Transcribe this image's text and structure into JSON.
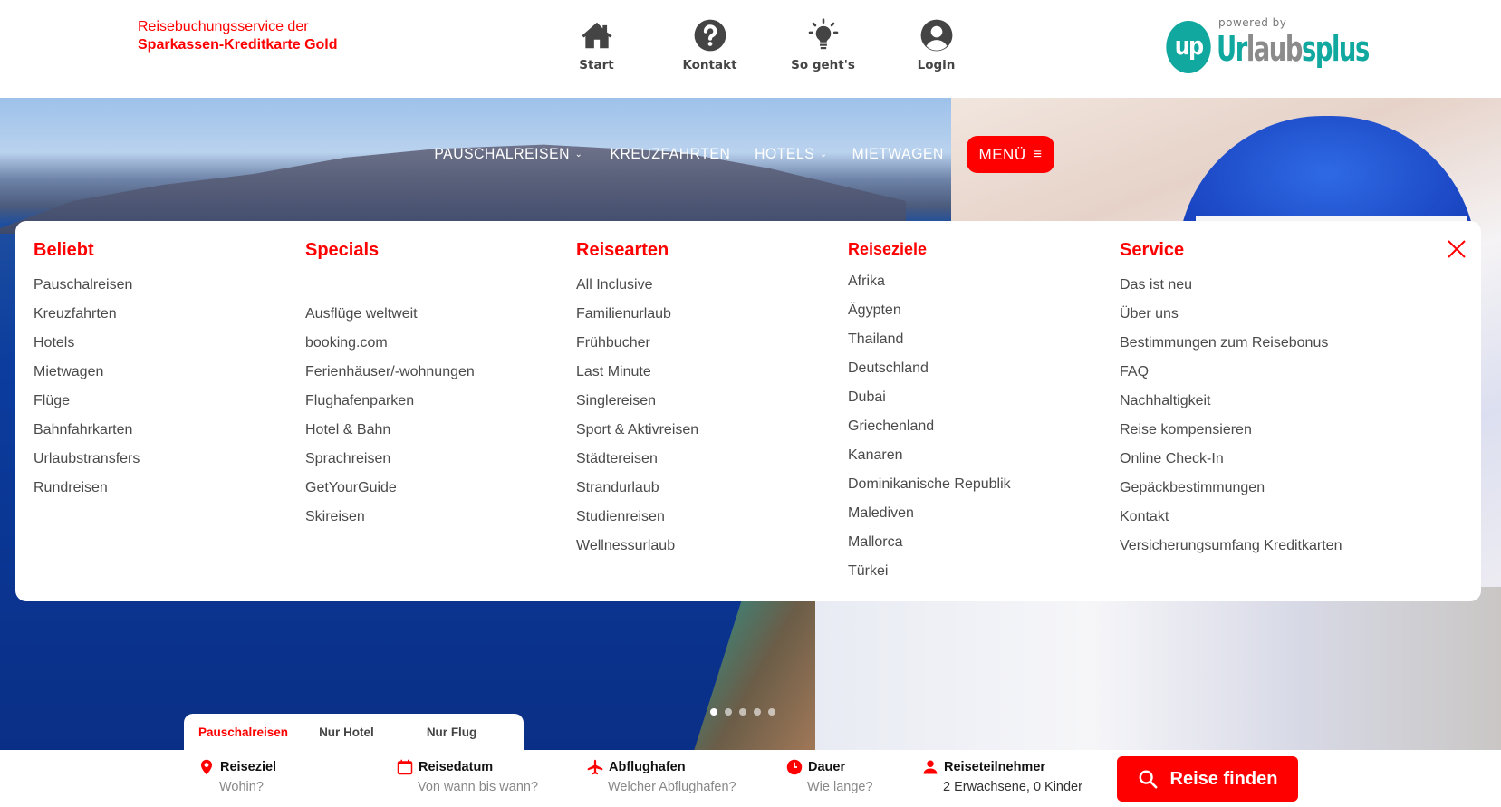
{
  "brand": {
    "line1": "Reisebuchungsservice der",
    "line2": "Sparkassen-Kreditkarte Gold",
    "color": "#ff0000"
  },
  "topnav": [
    {
      "label": "Start",
      "icon": "home-icon"
    },
    {
      "label": "Kontakt",
      "icon": "question-circle-icon"
    },
    {
      "label": "So geht's",
      "icon": "lightbulb-icon"
    },
    {
      "label": "Login",
      "icon": "user-circle-icon"
    }
  ],
  "logo": {
    "powered_by": "powered by",
    "mark": "up",
    "word_part1": "Ur",
    "word_part2": "laub",
    "word_part3": "splus",
    "color": "#10a89f"
  },
  "mainnav": {
    "items": [
      {
        "label": "PAUSCHALREISEN",
        "has_dropdown": true
      },
      {
        "label": "KREUZFAHRTEN",
        "has_dropdown": false
      },
      {
        "label": "HOTELS",
        "has_dropdown": true
      },
      {
        "label": "MIETWAGEN",
        "has_dropdown": false
      }
    ],
    "chevron": "⌄",
    "menu_label": "MENÜ",
    "menu_icon": "≡"
  },
  "megamenu": {
    "columns": [
      {
        "title": "Beliebt",
        "items": [
          "Pauschalreisen",
          "Kreuzfahrten",
          "Hotels",
          "Mietwagen",
          "Flüge",
          "Bahnfahrkarten",
          "Urlaubstransfers",
          "Rundreisen"
        ]
      },
      {
        "title": "Specials",
        "items": [
          "",
          "Ausflüge weltweit",
          "booking.com",
          "Ferienhäuser/-wohnungen",
          "Flughafenparken",
          "Hotel & Bahn",
          "Sprachreisen",
          "GetYourGuide",
          "Skireisen"
        ]
      },
      {
        "title": "Reisearten",
        "items": [
          "All Inclusive",
          "Familienurlaub",
          "Frühbucher",
          "Last Minute",
          "Singlereisen",
          "Sport & Aktivreisen",
          "Städtereisen",
          "Strandurlaub",
          "Studienreisen",
          "Wellnessurlaub"
        ]
      },
      {
        "title": "Reiseziele",
        "items": [
          "Afrika",
          "Ägypten",
          "Thailand",
          "Deutschland",
          "Dubai",
          "Griechenland",
          "Kanaren",
          "Dominikanische Republik",
          "Malediven",
          "Mallorca",
          "Türkei"
        ]
      },
      {
        "title": "Service",
        "items": [
          "Das ist neu",
          "Über uns",
          "Bestimmungen zum Reisebonus",
          "FAQ",
          "Nachhaltigkeit",
          "Reise kompensieren",
          "Online Check-In",
          "Gepäckbestimmungen",
          "Kontakt",
          "Versicherungsumfang Kreditkarten"
        ]
      }
    ],
    "close_icon": "close-icon",
    "accent": "#ff0000"
  },
  "carousel": {
    "slides": 5,
    "active": 1
  },
  "search": {
    "tabs": [
      {
        "label": "Pauschalreisen",
        "active": true
      },
      {
        "label": "Nur Hotel",
        "active": false
      },
      {
        "label": "Nur Flug",
        "active": false
      }
    ],
    "fields": [
      {
        "label": "Reiseziel",
        "placeholder": "Wohin?",
        "icon": "map-pin-icon"
      },
      {
        "label": "Reisedatum",
        "placeholder": "Von wann bis wann?",
        "icon": "calendar-icon"
      },
      {
        "label": "Abflughafen",
        "placeholder": "Welcher Abflughafen?",
        "icon": "airplane-icon"
      },
      {
        "label": "Dauer",
        "placeholder": "Wie lange?",
        "icon": "clock-icon"
      },
      {
        "label": "Reiseteilnehmer",
        "value": "2 Erwachsene, 0 Kinder",
        "icon": "person-icon"
      }
    ],
    "submit_label": "Reise finden"
  }
}
